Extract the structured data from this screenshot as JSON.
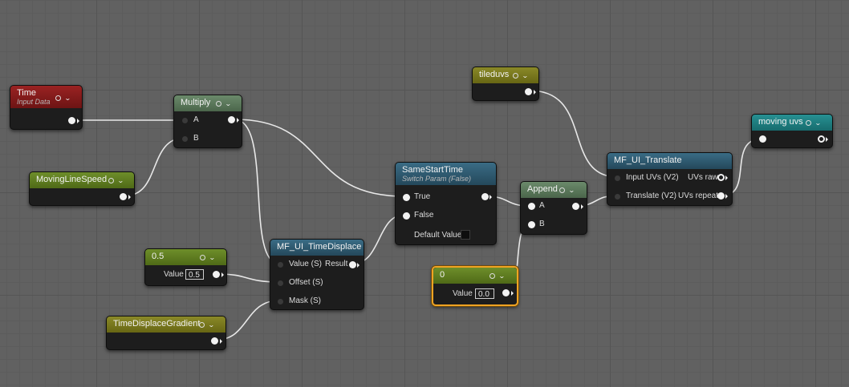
{
  "colors": {
    "red_header": "#8e1c1c",
    "green_header": "#5d7b5d",
    "lime_header": "#5f7d21",
    "olive_header": "#7b7a1f",
    "blue_header": "#2f5a70",
    "teal_header": "#1f7c7f",
    "selected_outline": "#f0a322",
    "wire": "#e8e8e8"
  },
  "nodes": {
    "time": {
      "title": "Time",
      "subtitle": "Input Data"
    },
    "multiply": {
      "title": "Multiply",
      "pin_a": "A",
      "pin_b": "B"
    },
    "moving_line_speed": {
      "title": "MovingLineSpeed"
    },
    "const_half": {
      "title": "0.5",
      "value_label": "Value",
      "value": "0.5"
    },
    "time_displace_gradient": {
      "title": "TimeDisplaceGradient"
    },
    "time_displace": {
      "title": "MF_UI_TimeDisplace",
      "in_value": "Value (S)",
      "in_offset": "Offset (S)",
      "in_mask": "Mask (S)",
      "out_result": "Result"
    },
    "same_start_time": {
      "title": "SameStartTime",
      "subtitle": "Switch Param (False)",
      "in_true": "True",
      "in_false": "False",
      "default_label": "Default Value"
    },
    "const_zero": {
      "title": "0",
      "value_label": "Value",
      "value": "0.0"
    },
    "append": {
      "title": "Append",
      "pin_a": "A",
      "pin_b": "B"
    },
    "tileduvs": {
      "title": "tileduvs"
    },
    "translate": {
      "title": "MF_UI_Translate",
      "in_uvs": "Input UVs (V2)",
      "in_translate": "Translate (V2)",
      "out_raw": "UVs raw",
      "out_repeat": "UVs repeat"
    },
    "moving_uvs": {
      "title": "moving uvs"
    }
  }
}
